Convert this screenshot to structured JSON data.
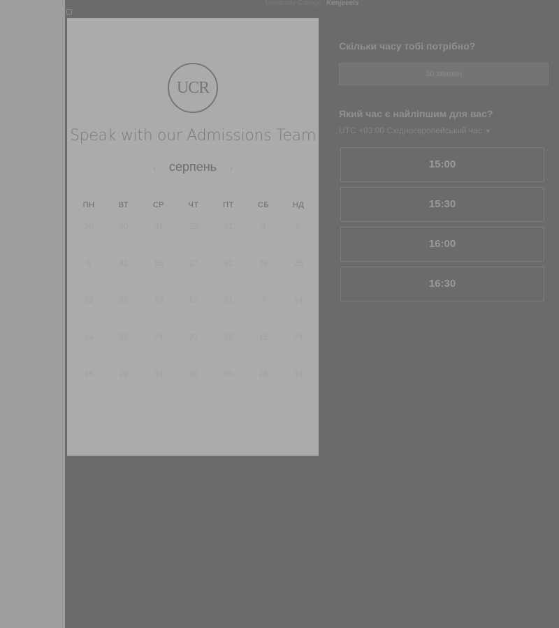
{
  "header": {
    "college_text": "University College",
    "brand_text": "Kenjeeels"
  },
  "card": {
    "logo_text": "UCR",
    "title": "Speak with our Admissions Team",
    "month": "серпень",
    "prev_icon": "chevron-left-icon",
    "next_icon": "chevron-right-icon",
    "weekdays": [
      "ПН",
      "ВТ",
      "СР",
      "ЧТ",
      "ПТ",
      "СБ",
      "НД"
    ],
    "weeks": [
      [
        "30",
        "30",
        "31",
        "29",
        "31",
        "4",
        "5"
      ],
      [
        "6",
        "31",
        "15",
        "27",
        "31",
        "29",
        "25"
      ],
      [
        "22",
        "22",
        "13",
        "13",
        "31",
        "3",
        "14"
      ],
      [
        "14",
        "28",
        "24",
        "21",
        "22",
        "15",
        "24"
      ],
      [
        "15",
        "29",
        "31",
        "25",
        "20",
        "28",
        "31"
      ]
    ]
  },
  "scheduler": {
    "duration_question": "Скільки часу тобі потрібно?",
    "duration_value": "30 хвилин",
    "time_question": "Який час є найліпшим для вас?",
    "timezone": "UTC +03:00 Східноєвропейський час",
    "timezone_icon": "chevron-down-icon",
    "slots": [
      "15:00",
      "15:30",
      "16:00",
      "16:30"
    ]
  }
}
